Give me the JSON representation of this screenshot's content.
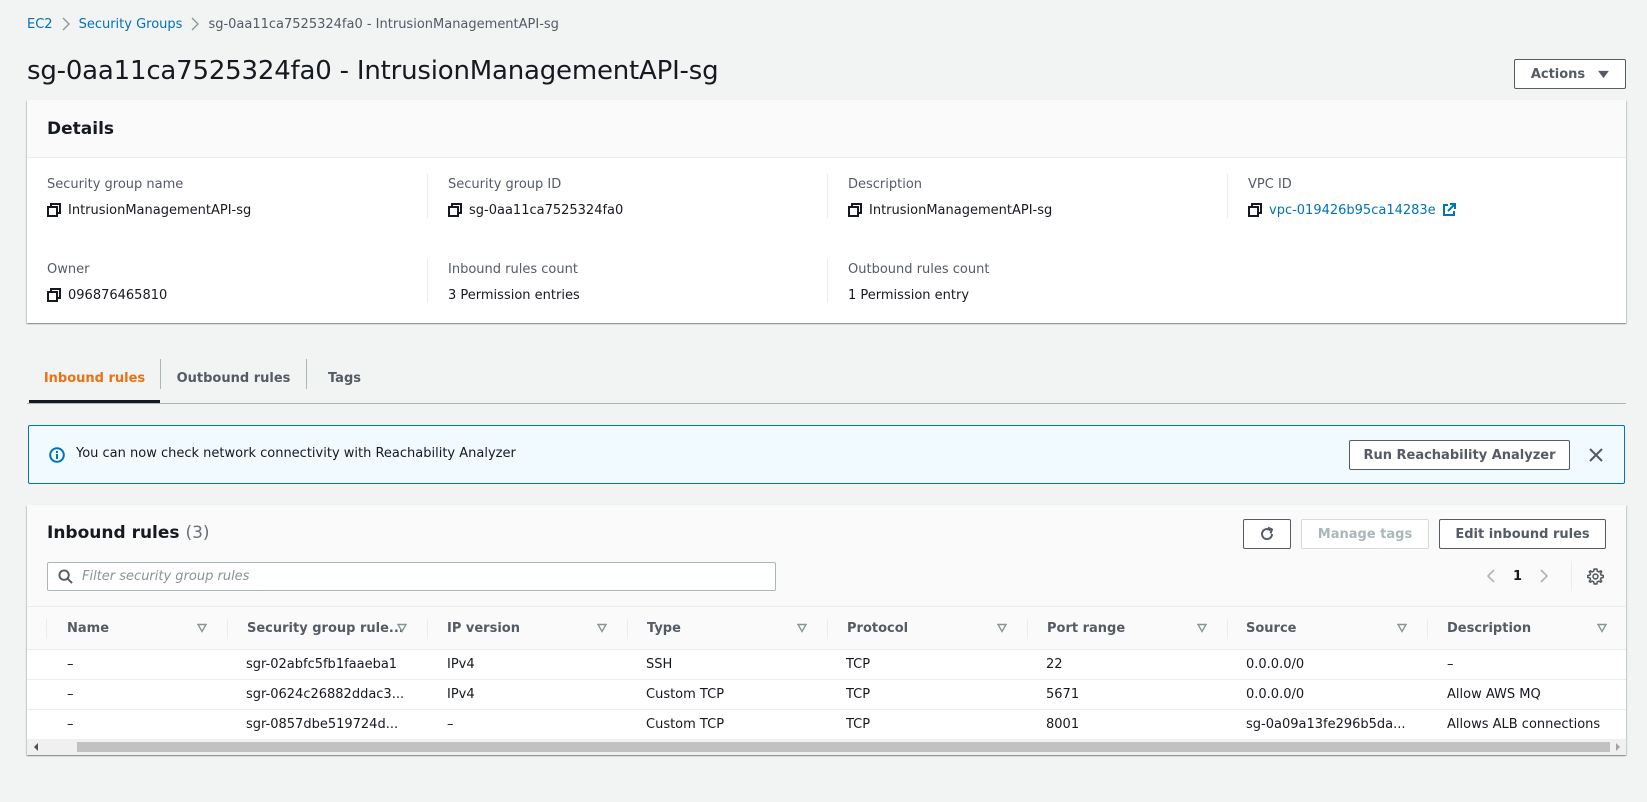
{
  "breadcrumb": {
    "items": [
      {
        "label": "EC2"
      },
      {
        "label": "Security Groups"
      },
      {
        "label": "sg-0aa11ca7525324fa0 - IntrusionManagementAPI-sg"
      }
    ]
  },
  "page": {
    "title": "sg-0aa11ca7525324fa0 - IntrusionManagementAPI-sg",
    "actions_label": "Actions"
  },
  "details": {
    "title": "Details",
    "fields": [
      {
        "label": "Security group name",
        "value": "IntrusionManagementAPI-sg",
        "copyable": true
      },
      {
        "label": "Security group ID",
        "value": "sg-0aa11ca7525324fa0",
        "copyable": true
      },
      {
        "label": "Description",
        "value": "IntrusionManagementAPI-sg",
        "copyable": true
      },
      {
        "label": "VPC ID",
        "value": "vpc-019426b95ca14283e",
        "copyable": true,
        "link": true
      },
      {
        "label": "Owner",
        "value": "096876465810",
        "copyable": true
      },
      {
        "label": "Inbound rules count",
        "value": "3 Permission entries"
      },
      {
        "label": "Outbound rules count",
        "value": "1 Permission entry"
      }
    ]
  },
  "tabs": [
    {
      "label": "Inbound rules",
      "active": true
    },
    {
      "label": "Outbound rules",
      "active": false
    },
    {
      "label": "Tags",
      "active": false
    }
  ],
  "flash": {
    "message": "You can now check network connectivity with Reachability Analyzer",
    "button_label": "Run Reachability Analyzer"
  },
  "inbound": {
    "title": "Inbound rules",
    "count": "(3)",
    "refresh_label": "Refresh",
    "manage_tags_label": "Manage tags",
    "edit_label": "Edit inbound rules",
    "search_placeholder": "Filter security group rules",
    "search_value": "",
    "page": "1",
    "columns": [
      "Name",
      "Security group rule...",
      "IP version",
      "Type",
      "Protocol",
      "Port range",
      "Source",
      "Description"
    ],
    "rows": [
      [
        "–",
        "sgr-02abfc5fb1faaeba1",
        "IPv4",
        "SSH",
        "TCP",
        "22",
        "0.0.0.0/0",
        "–"
      ],
      [
        "–",
        "sgr-0624c26882ddac3...",
        "IPv4",
        "Custom TCP",
        "TCP",
        "5671",
        "0.0.0.0/0",
        "Allow AWS MQ"
      ],
      [
        "–",
        "sgr-0857dbe519724d...",
        "–",
        "Custom TCP",
        "TCP",
        "8001",
        "sg-0a09a13fe296b5da...",
        "Allows ALB connections"
      ]
    ]
  },
  "colors": {
    "link": "#0073bb",
    "active_tab": "#ec7211",
    "flash_border": "#0073bb",
    "flash_bg": "#f1faff",
    "page_bg": "#f2f3f3"
  }
}
